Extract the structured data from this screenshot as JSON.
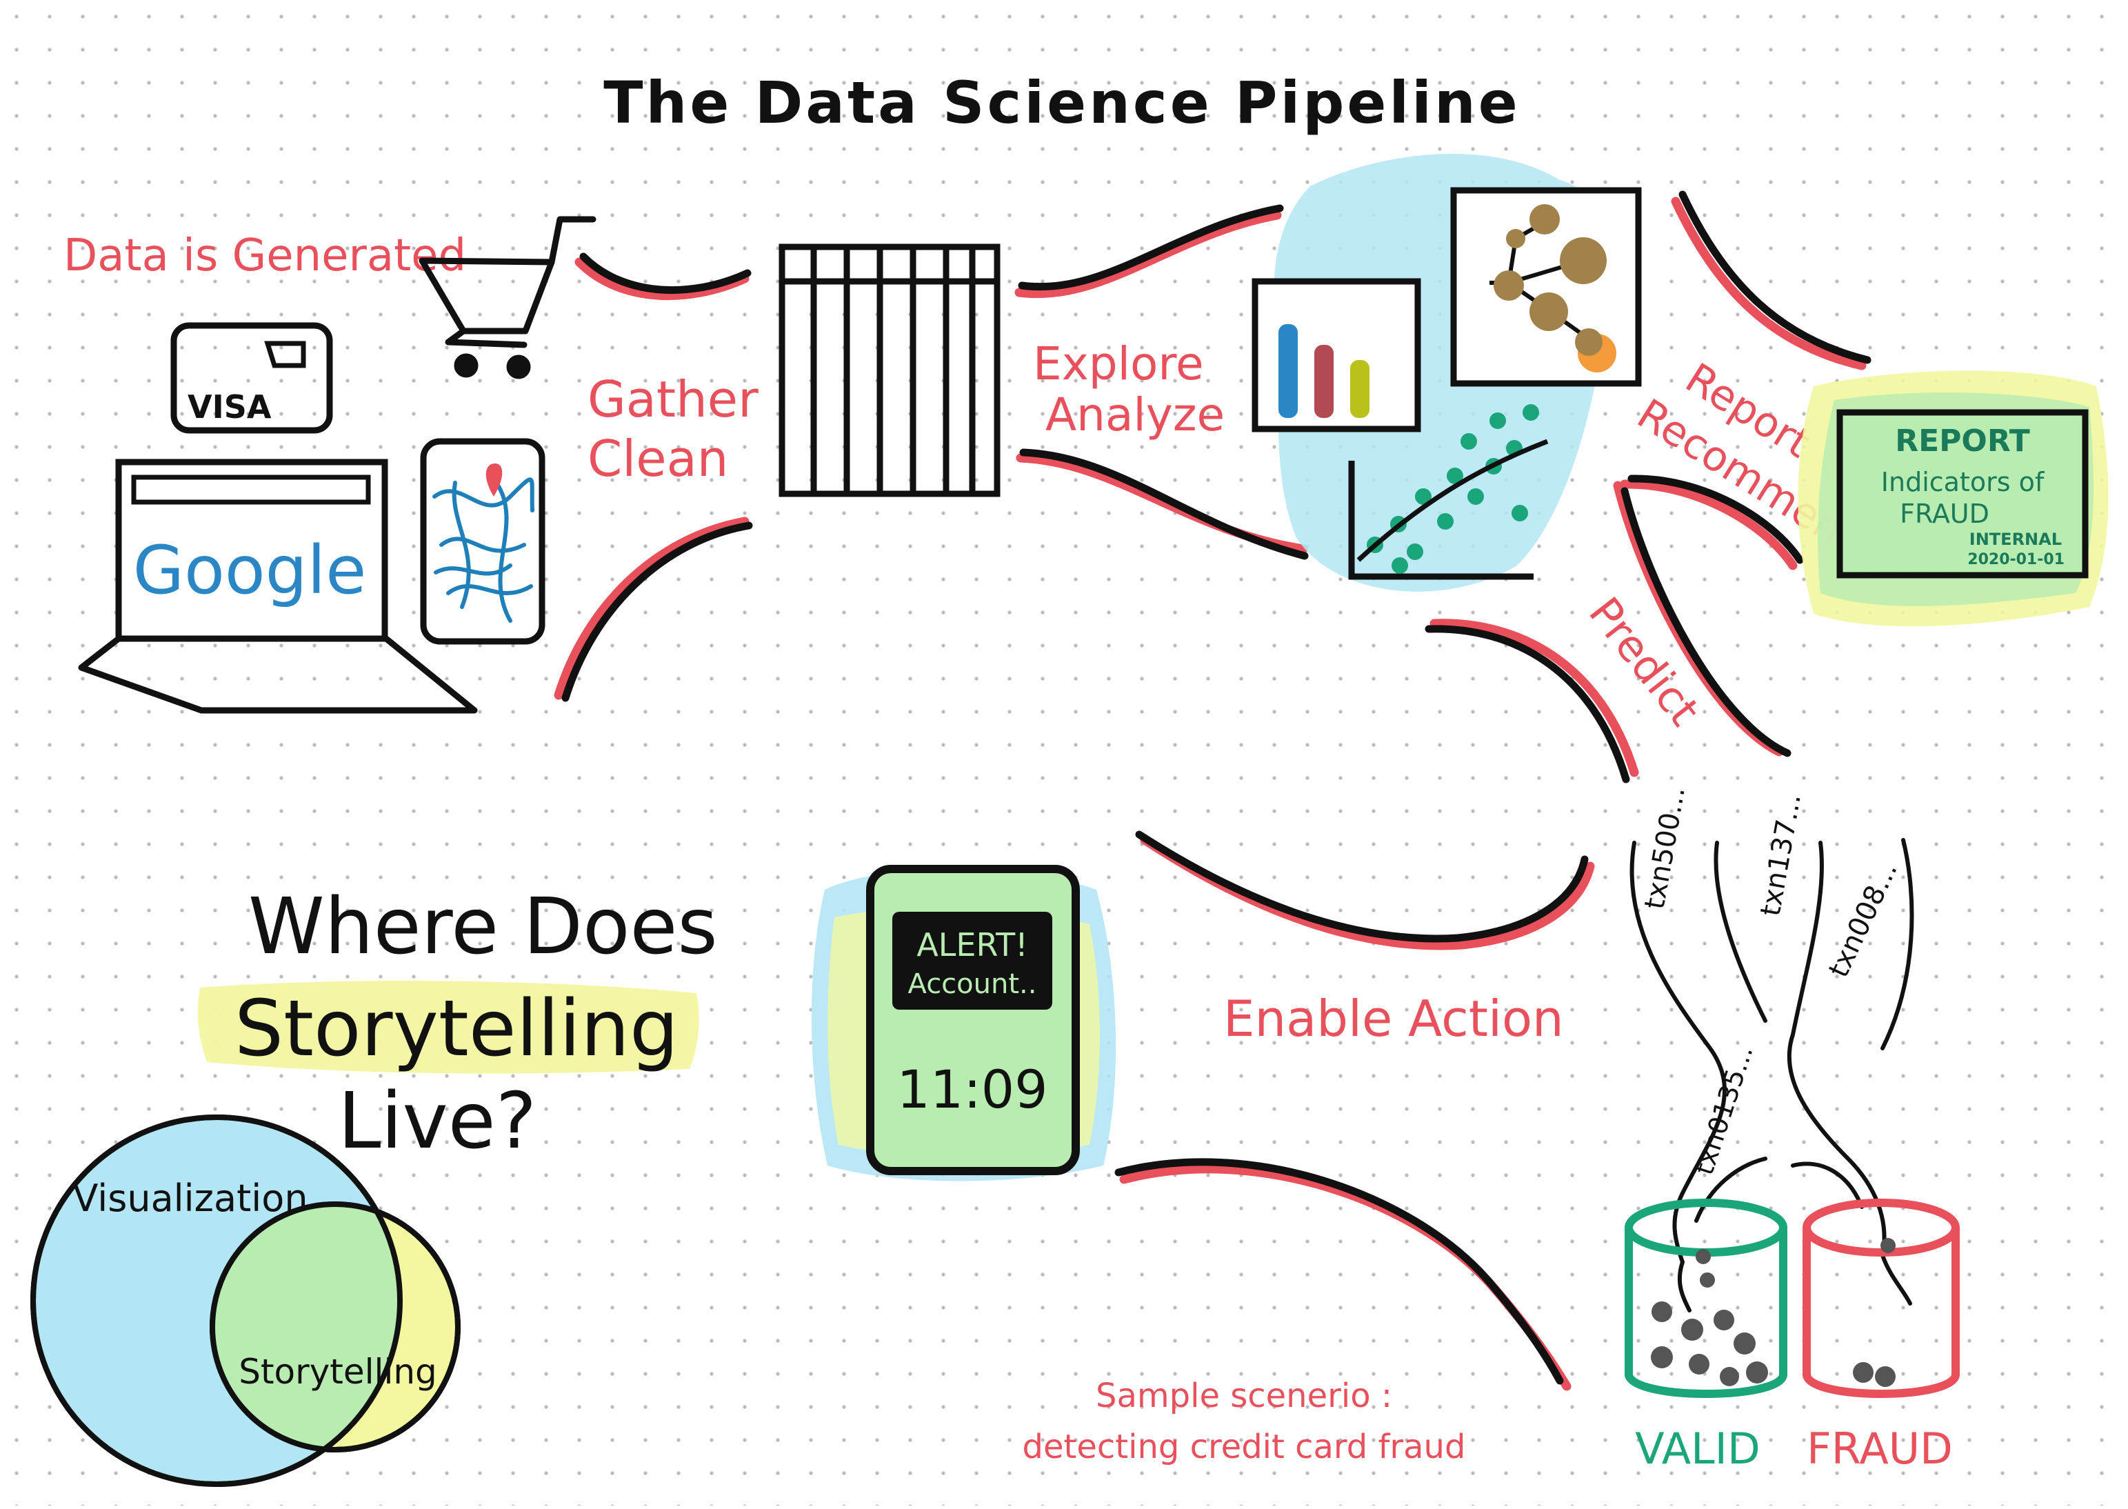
{
  "title": "The Data Science Pipeline",
  "colors": {
    "red": "#e8505b",
    "black": "#111111",
    "blue_hl": "#b3e6f5",
    "yellow_hl": "#f2f7a0",
    "green_hl": "#b8ecb0",
    "teal": "#1aa57a",
    "gbar_blue": "#2a86c4",
    "gbar_red": "#b14a52",
    "gbar_yellow": "#b9c21a",
    "node_brown": "#a0824a",
    "node_orange": "#f39a3a",
    "map_blue": "#1f7fb8",
    "valid_green": "#1aa57a",
    "fraud_red": "#e8505b",
    "dot_gray": "#555555"
  },
  "stages": {
    "generated": "Data is Generated",
    "gather": "Gather",
    "clean": "Clean",
    "explore": "Explore",
    "analyze": "Analyze",
    "report": "Report",
    "recommend": "Recommend",
    "predict": "Predict",
    "enable_action": "Enable Action"
  },
  "sources": {
    "card_brand": "VISA",
    "search_brand": "Google"
  },
  "report_doc": {
    "heading": "REPORT",
    "line1": "Indicators of",
    "line2": "FRAUD",
    "stamp": "INTERNAL",
    "date": "2020-01-01"
  },
  "phone": {
    "alert_line1": "ALERT!",
    "alert_line2": "Account..",
    "time": "11:09"
  },
  "question": {
    "line1": "Where Does",
    "line2": "Storytelling",
    "line3": "Live?"
  },
  "venn": {
    "outer_label": "Visualization",
    "inner_label": "Storytelling"
  },
  "transactions": [
    "txn500...",
    "txn137...",
    "txn008...",
    "txn0135..."
  ],
  "bins": {
    "valid": "VALID",
    "fraud": "FRAUD"
  },
  "scenario": {
    "line1": "Sample scenerio :",
    "line2": "detecting credit card fraud"
  }
}
